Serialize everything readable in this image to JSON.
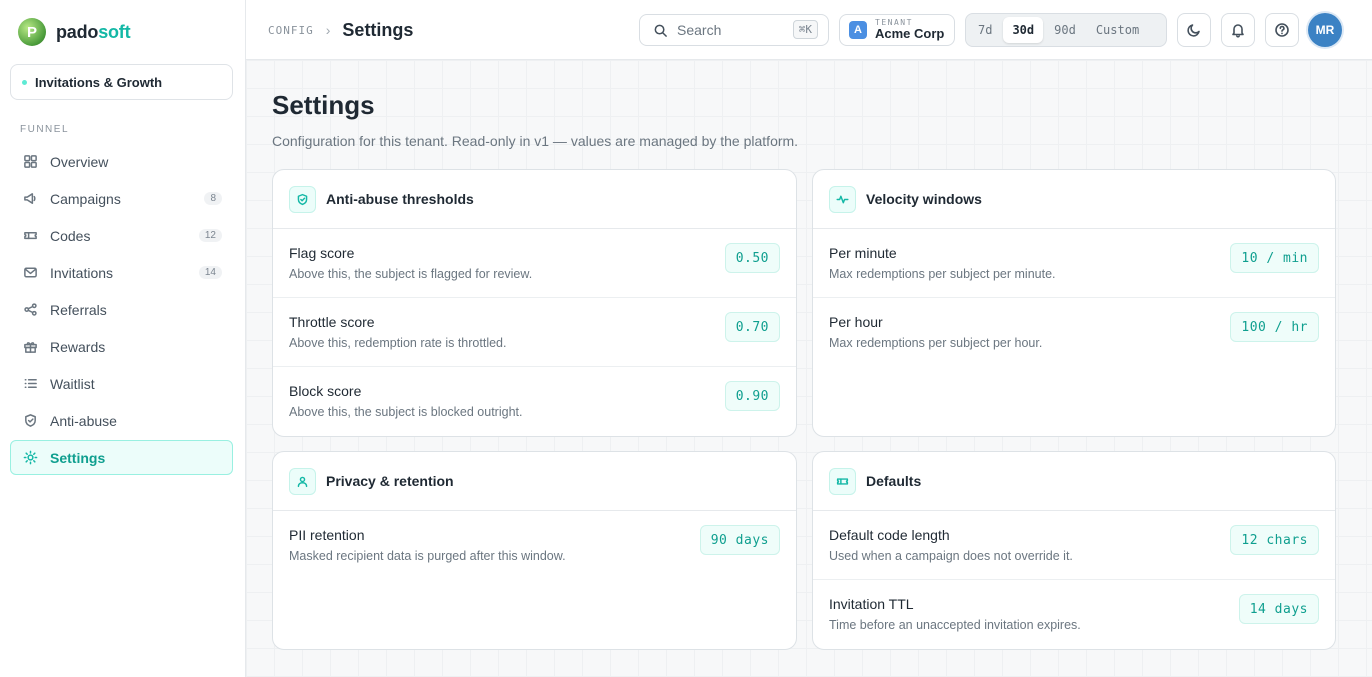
{
  "brand": {
    "part1": "pado",
    "part2": "soft",
    "logo_letter": "P",
    "accent": "#14b8a6"
  },
  "workspace": {
    "label": "Invitations & Growth"
  },
  "sidebar": {
    "section_label": "FUNNEL",
    "items": [
      {
        "label": "Overview",
        "icon": "grid-icon",
        "count": ""
      },
      {
        "label": "Campaigns",
        "icon": "megaphone-icon",
        "count": "8"
      },
      {
        "label": "Codes",
        "icon": "ticket-icon",
        "count": "12"
      },
      {
        "label": "Invitations",
        "icon": "mail-icon",
        "count": "14"
      },
      {
        "label": "Referrals",
        "icon": "share-icon",
        "count": ""
      },
      {
        "label": "Rewards",
        "icon": "gift-icon",
        "count": ""
      },
      {
        "label": "Waitlist",
        "icon": "list-icon",
        "count": ""
      },
      {
        "label": "Anti-abuse",
        "icon": "shield-icon",
        "count": ""
      },
      {
        "label": "Settings",
        "icon": "sun-icon",
        "count": "",
        "active": true
      }
    ]
  },
  "topbar": {
    "breadcrumb_parent": "CONFIG",
    "breadcrumb_sep": "›",
    "breadcrumb_current": "Settings",
    "search_placeholder": "Search",
    "search_shortcut": "⌘K",
    "tenant_label": "TENANT",
    "tenant_badge": "A",
    "tenant_name": "Acme Corp",
    "ranges": [
      "7d",
      "30d",
      "90d",
      "Custom"
    ],
    "selected_range": "30d",
    "avatar_initials": "MR"
  },
  "page": {
    "title": "Settings",
    "subtitle": "Configuration for this tenant. Read-only in v1 — values are managed by the platform."
  },
  "cards": {
    "anti_abuse": {
      "title": "Anti-abuse thresholds",
      "icon": "shield-check-icon",
      "rows": [
        {
          "label": "Flag score",
          "desc": "Above this, the subject is flagged for review.",
          "value": "0.50"
        },
        {
          "label": "Throttle score",
          "desc": "Above this, redemption rate is throttled.",
          "value": "0.70"
        },
        {
          "label": "Block score",
          "desc": "Above this, the subject is blocked outright.",
          "value": "0.90"
        }
      ]
    },
    "velocity": {
      "title": "Velocity windows",
      "icon": "activity-icon",
      "rows": [
        {
          "label": "Per minute",
          "desc": "Max redemptions per subject per minute.",
          "value": "10 / min"
        },
        {
          "label": "Per hour",
          "desc": "Max redemptions per subject per hour.",
          "value": "100 / hr"
        }
      ]
    },
    "privacy": {
      "title": "Privacy & retention",
      "icon": "user-icon",
      "rows": [
        {
          "label": "PII retention",
          "desc": "Masked recipient data is purged after this window.",
          "value": "90 days"
        }
      ]
    },
    "defaults": {
      "title": "Defaults",
      "icon": "ticket-icon",
      "rows": [
        {
          "label": "Default code length",
          "desc": "Used when a campaign does not override it.",
          "value": "12 chars"
        },
        {
          "label": "Invitation TTL",
          "desc": "Time before an unaccepted invitation expires.",
          "value": "14 days"
        }
      ]
    }
  }
}
